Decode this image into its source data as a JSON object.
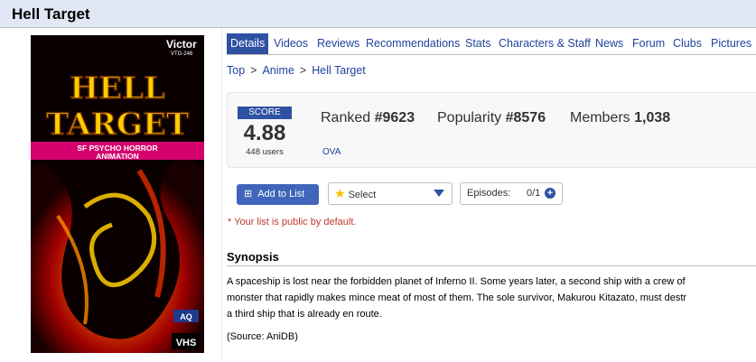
{
  "page": {
    "title": "Hell Target"
  },
  "cover": {
    "logo": "Victor",
    "catalog": "VTG-246",
    "title_line1": "HELL",
    "title_line2": "TARGET",
    "subtitle_line1": "SF PSYCHO HORROR",
    "subtitle_line2": "ANIMATION",
    "corner_badge": "VHS",
    "corner_logo": "AQ"
  },
  "nav": {
    "tabs": [
      {
        "label": "Details"
      },
      {
        "label": "Videos"
      },
      {
        "label": "Reviews"
      },
      {
        "label": "Recommendations"
      },
      {
        "label": "Stats"
      },
      {
        "label": "Characters & Staff"
      },
      {
        "label": "News"
      },
      {
        "label": "Forum"
      },
      {
        "label": "Clubs"
      },
      {
        "label": "Pictures"
      }
    ]
  },
  "breadcrumb": {
    "items": [
      "Top",
      "Anime",
      "Hell Target"
    ],
    "separator": ">"
  },
  "stats": {
    "score_label": "SCORE",
    "score": "4.88",
    "users": "448 users",
    "ranked_label": "Ranked",
    "ranked_value": "#9623",
    "popularity_label": "Popularity",
    "popularity_value": "#8576",
    "members_label": "Members",
    "members_value": "1,038",
    "type": "OVA"
  },
  "controls": {
    "add_label": "Add to List",
    "select_label": "Select",
    "episodes_label": "Episodes:",
    "episodes_value": "0/1"
  },
  "notes": {
    "public": "* Your list is public by default."
  },
  "synopsis": {
    "heading": "Synopsis",
    "lines": [
      "A spaceship is lost near the forbidden planet of Inferno II. Some years later, a second ship with a crew of",
      "monster that rapidly makes mince meat of most of them. The sole survivor, Makurou Kitazato, must destr",
      "a third ship that is already en route."
    ],
    "source": "(Source: AniDB)"
  },
  "colors": {
    "brand": "#2e51a2",
    "link": "#1d439b",
    "title_bar": "#e1e7f5",
    "warning": "#c0392b"
  }
}
